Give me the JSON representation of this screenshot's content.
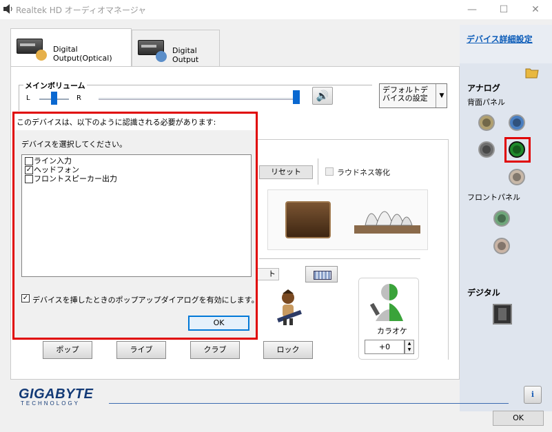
{
  "window": {
    "title": "Realtek HD オーディオマネージャ",
    "min_glyph": "—",
    "max_glyph": "☐",
    "close_glyph": "✕"
  },
  "tabs": [
    {
      "label": "Digital Output(Optical)",
      "selected": true
    },
    {
      "label": "Digital Output",
      "selected": false
    }
  ],
  "volume": {
    "title": "メインボリューム",
    "left_label": "L",
    "right_label": "R",
    "balance": 0.5,
    "level": 1.0,
    "speaker_glyph": "🔊"
  },
  "default_device": {
    "label": "デフォルトデバイスの設定",
    "arrow": "▼"
  },
  "effects": {
    "reset_label": "リセット",
    "loudness_label": "ラウドネス等化",
    "hidden_button_tail": "ト"
  },
  "karaoke": {
    "label": "カラオケ",
    "value": "+0",
    "up": "▲",
    "down": "▼"
  },
  "presets": [
    "ポップ",
    "ライブ",
    "クラブ",
    "ロック"
  ],
  "side_panel": {
    "device_detail_link": "デバイス詳細設定",
    "analog_label": "アナログ",
    "rear_panel_label": "背面パネル",
    "front_panel_label": "フロントパネル",
    "digital_label": "デジタル",
    "jack_colors": {
      "rear_1": "#b0a070",
      "rear_2": "#4a7fc1",
      "rear_3": "#6f6f6f",
      "rear_4_selected": "#1f8a2c",
      "rear_5": "#c8b8a8",
      "front_1": "#6fa67a",
      "front_2": "#c9b4a5"
    }
  },
  "footer": {
    "brand": "GIGABYTE",
    "brand_sub": "TECHNOLOGY",
    "info_glyph": "i",
    "ok_label": "OK"
  },
  "dialog": {
    "prompt": "このデバイスは、以下のように認識される必要があります:",
    "instruction": "デバイスを選択してください。",
    "items": [
      {
        "label": "ライン入力",
        "checked": false
      },
      {
        "label": "ヘッドフォン",
        "checked": true
      },
      {
        "label": "フロントスピーカー出力",
        "checked": false
      }
    ],
    "enable_popup_label": "デバイスを挿したときのポップアップダイアログを有効にします。",
    "enable_popup_checked": true,
    "ok_label": "OK",
    "check_glyph": "✓",
    "accent_color": "#e00000"
  }
}
